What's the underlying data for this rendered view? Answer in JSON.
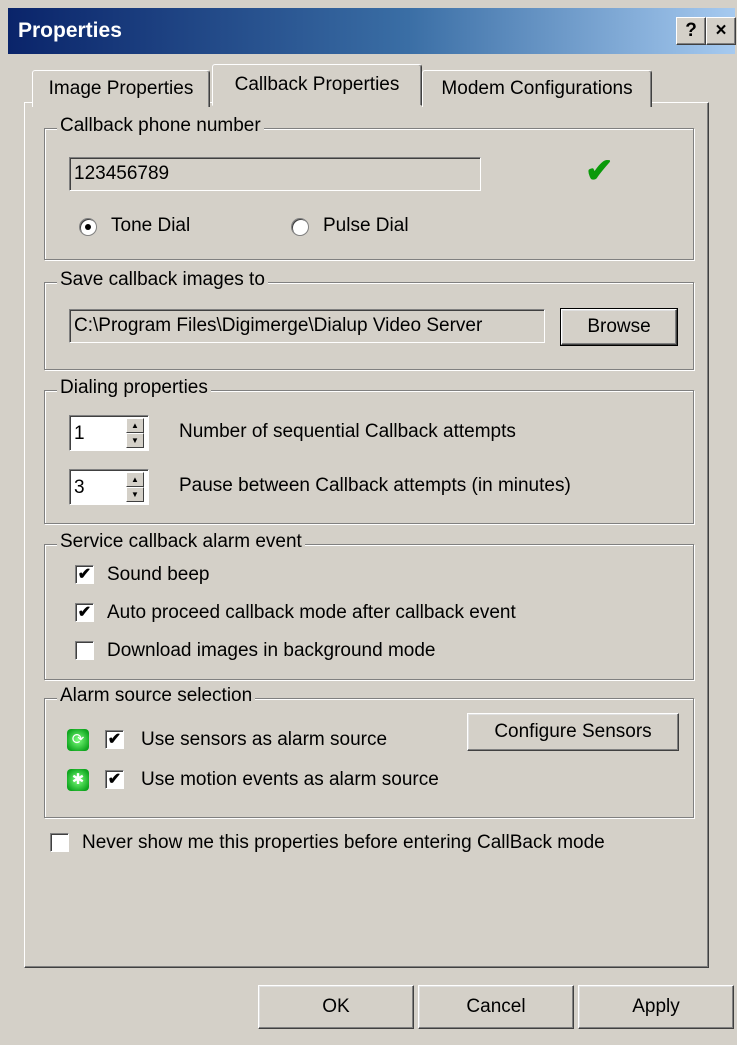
{
  "window": {
    "title": "Properties",
    "help_button": "?",
    "close_button": "×"
  },
  "tabs": [
    {
      "label": "Image Properties",
      "active": false
    },
    {
      "label": "Callback Properties",
      "active": true
    },
    {
      "label": "Modem Configurations",
      "active": false
    }
  ],
  "phone_group": {
    "legend": "Callback phone number",
    "phone_value": "123456789",
    "valid_icon": "checkmark-icon",
    "valid_color": "#0a9a0a",
    "tone_label": "Tone Dial",
    "tone_selected": true,
    "pulse_label": "Pulse Dial",
    "pulse_selected": false
  },
  "save_group": {
    "legend": "Save callback images to",
    "path_value": "C:\\Program Files\\Digimerge\\Dialup Video Server",
    "browse_label": "Browse"
  },
  "dialing_group": {
    "legend": "Dialing properties",
    "attempts_value": "1",
    "attempts_label": "Number of sequential Callback attempts",
    "pause_value": "3",
    "pause_label": "Pause between Callback attempts (in minutes)"
  },
  "alarm_event_group": {
    "legend": "Service callback alarm event",
    "items": [
      {
        "label": "Sound beep",
        "checked": true
      },
      {
        "label": "Auto proceed callback mode after callback event",
        "checked": true
      },
      {
        "label": "Download images in background mode",
        "checked": false
      }
    ]
  },
  "alarm_source_group": {
    "legend": "Alarm source selection",
    "sensors_label": "Use sensors as alarm source",
    "sensors_checked": true,
    "motion_label": "Use motion events as alarm source",
    "motion_checked": true,
    "configure_label": "Configure Sensors"
  },
  "never_show": {
    "label": "Never show me this properties before entering CallBack mode",
    "checked": false
  },
  "footer": {
    "ok_label": "OK",
    "cancel_label": "Cancel",
    "apply_label": "Apply"
  },
  "check_glyph": "✔"
}
